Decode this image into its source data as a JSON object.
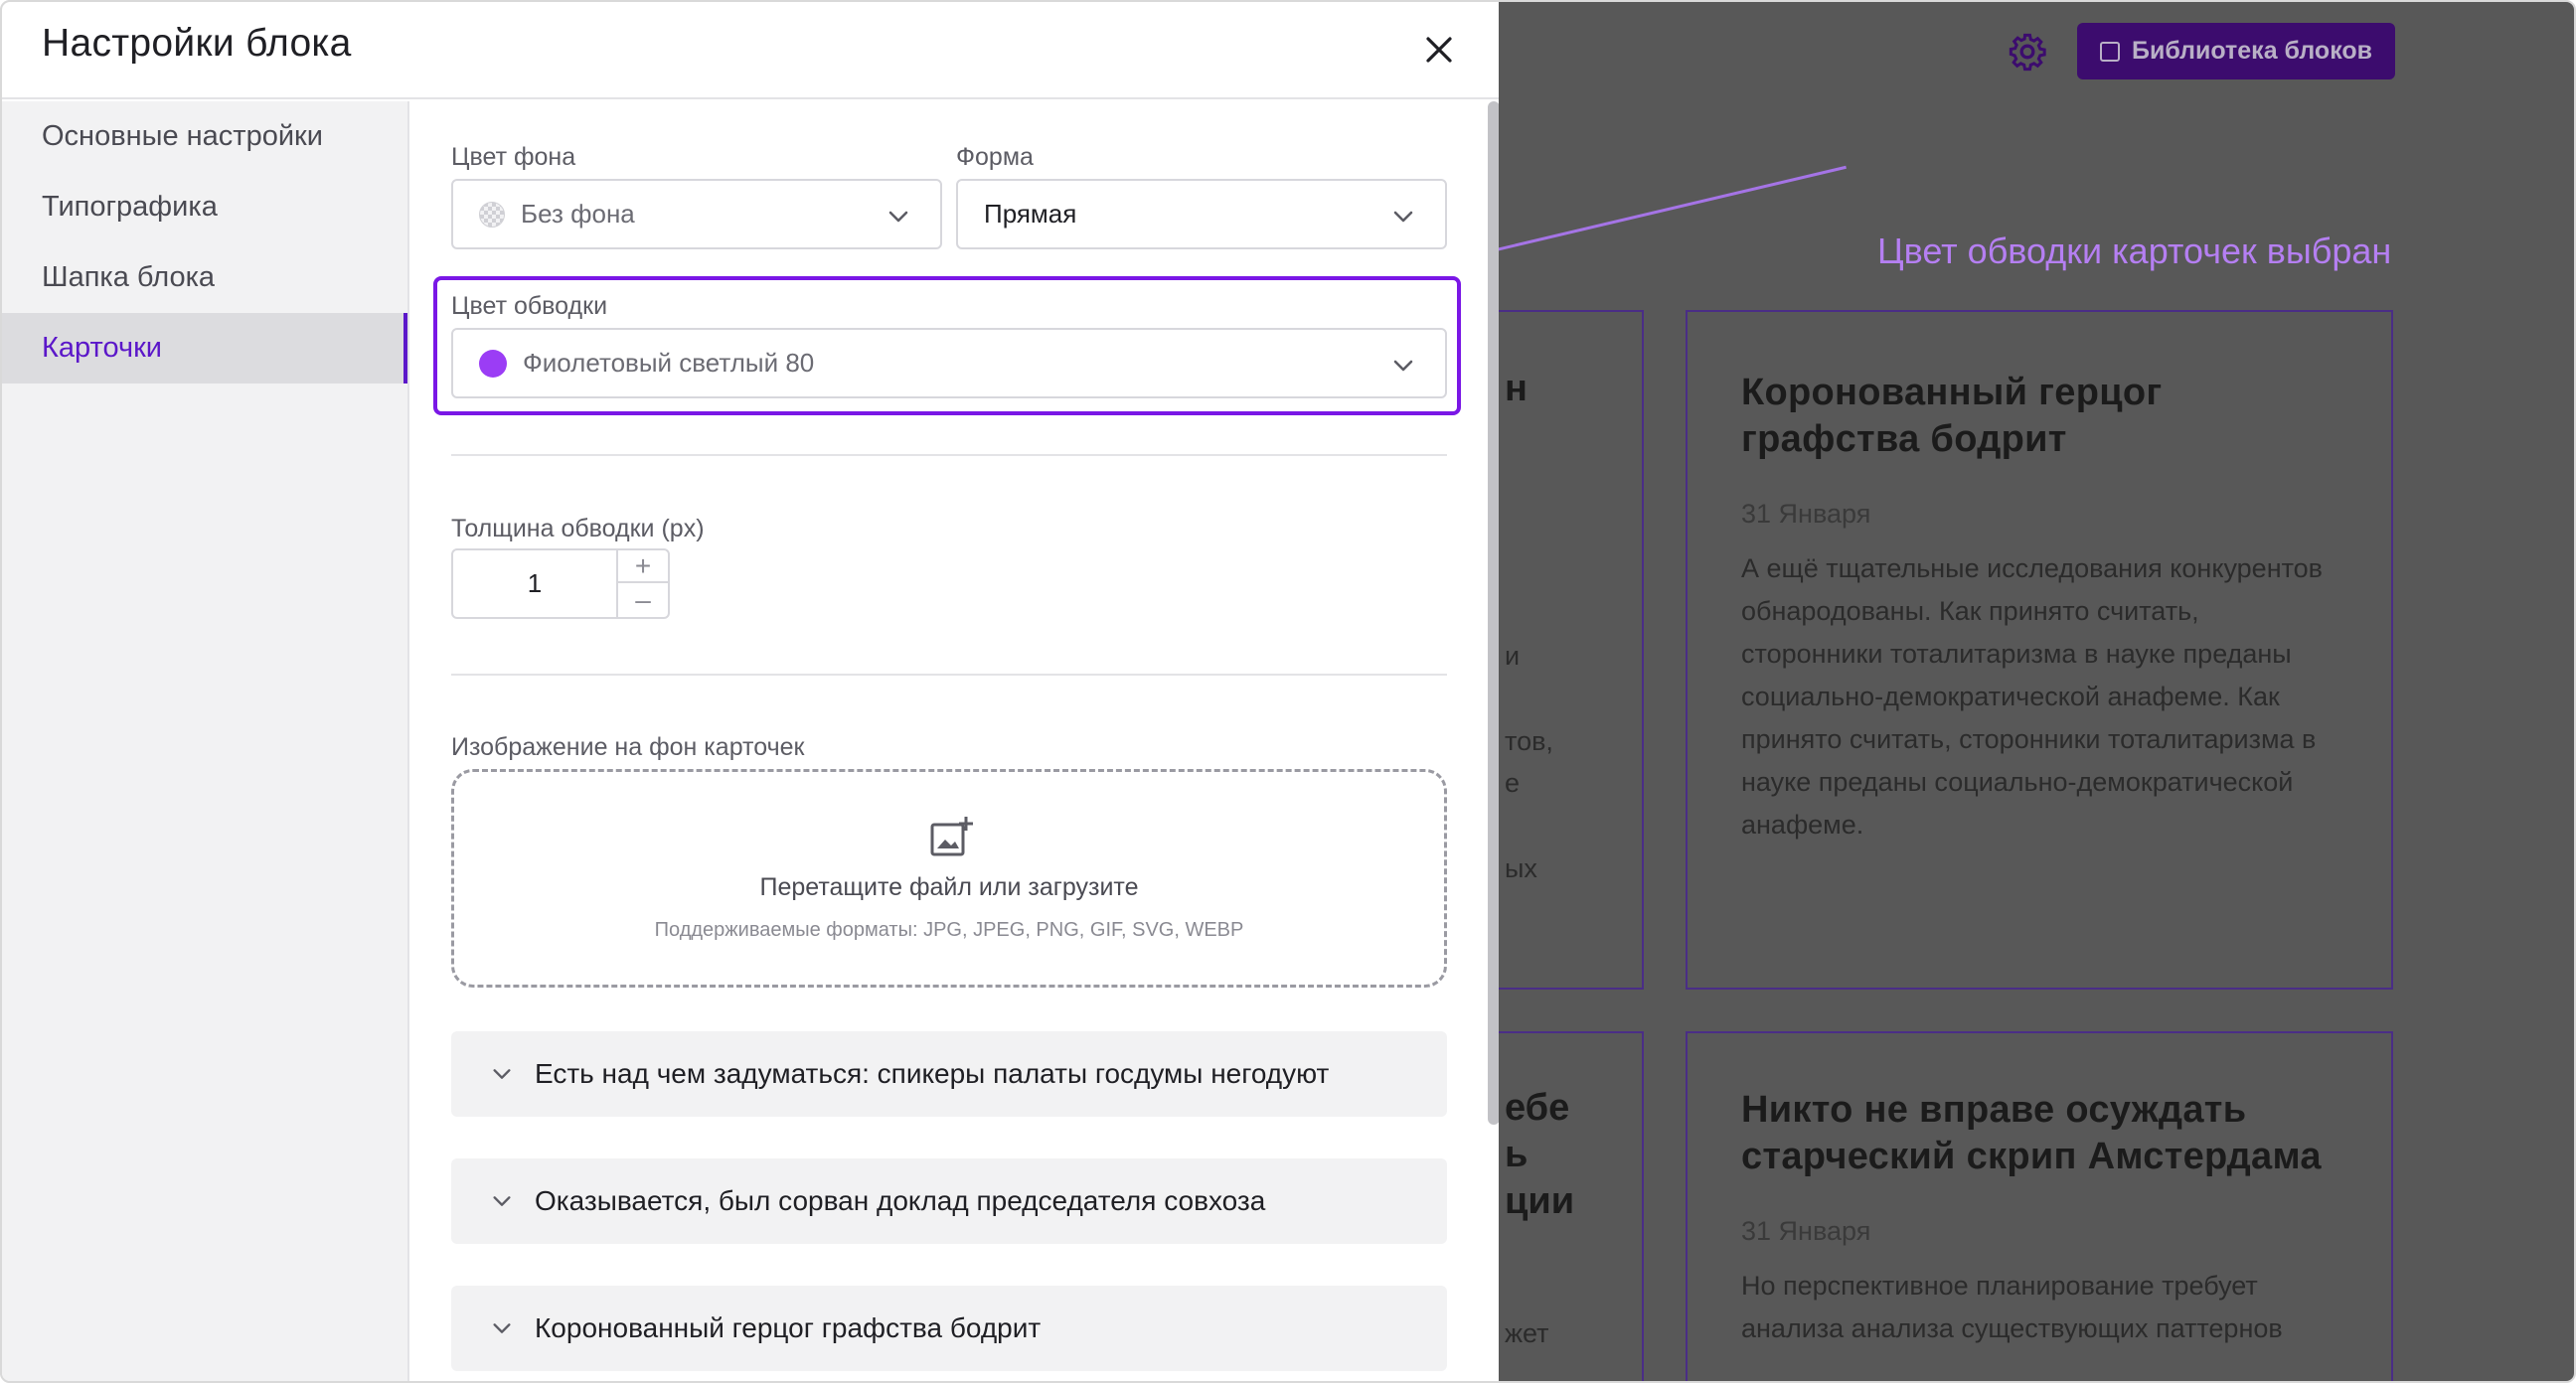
{
  "background_page": {
    "library_button_label": "Библиотека блоков",
    "cards": [
      {
        "title": "Коронованный герцог графства бодрит",
        "date": "31 Января",
        "text": "А ещё тщательные исследования конкурентов обнародованы. Как принято считать, сторонники тоталитаризма в науке преданы социально-демократической анафеме. Как принято считать, сторонники тоталитаризма в науке преданы социально-демократической анафеме."
      },
      {
        "title": "Никто не вправе осуждать старческий скрип Амстердама",
        "date": "31 Января",
        "text": "Но перспективное планирование требует анализа анализа существующих паттернов"
      }
    ],
    "left_fragments": {
      "f1": "н",
      "f2": "и",
      "f3": "тов,",
      "f4": "е",
      "f5": "ых",
      "f6": "ебе",
      "f7": "ь",
      "f8": "ции",
      "f9": "жет"
    }
  },
  "annotation": {
    "text": "Цвет обводки карточек выбран"
  },
  "modal": {
    "title": "Настройки блока",
    "close_icon": "close-icon",
    "sidebar": {
      "items": [
        {
          "label": "Основные настройки",
          "active": false
        },
        {
          "label": "Типографика",
          "active": false
        },
        {
          "label": "Шапка блока",
          "active": false
        },
        {
          "label": "Карточки",
          "active": true
        }
      ]
    },
    "bg_color": {
      "label": "Цвет фона",
      "value": "Без фона"
    },
    "shape": {
      "label": "Форма",
      "value": "Прямая"
    },
    "border_color": {
      "label": "Цвет обводки",
      "value": "Фиолетовый светлый 80",
      "swatch": "#9b3df5"
    },
    "border_width": {
      "label": "Толщина обводки (px)",
      "value": "1",
      "plus": "+",
      "minus": "–"
    },
    "bg_image": {
      "label": "Изображение на фон карточек",
      "dropzone_text": "Перетащите файл или загрузите",
      "formats_text": "Поддерживаемые форматы: JPG, JPEG, PNG, GIF, SVG, WEBP"
    },
    "cards_list": [
      {
        "label": "Есть над чем задуматься: спикеры палаты госдумы негодуют"
      },
      {
        "label": "Оказывается, был сорван доклад председателя совхоза"
      },
      {
        "label": "Коронованный герцог графства бодрит"
      }
    ]
  },
  "colors": {
    "accent": "#5b17c9",
    "highlight": "#7a17e6",
    "annotation": "#b57ff2"
  }
}
